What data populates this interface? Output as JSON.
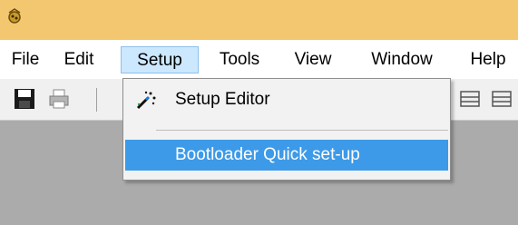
{
  "colors": {
    "titlebar": "#f2c76f",
    "menubar": "#ffffff",
    "workspace": "#ababab",
    "toolbar": "#f0f0f0",
    "highlight": "#3d9ae8"
  },
  "window": {
    "app_icon": "app-logo-icon"
  },
  "menubar": {
    "items": [
      {
        "label": "File"
      },
      {
        "label": "Edit"
      },
      {
        "label": "Setup",
        "active": true
      },
      {
        "label": "Tools"
      },
      {
        "label": "View"
      },
      {
        "label": "Window"
      },
      {
        "label": "Help"
      }
    ]
  },
  "toolbar": {
    "buttons": [
      {
        "icon": "save-icon"
      },
      {
        "icon": "print-icon"
      },
      {
        "icon": "layout-icon"
      },
      {
        "icon": "layout-alt-icon"
      }
    ]
  },
  "setup_menu": {
    "items": [
      {
        "label": "Setup Editor",
        "icon": "magic-wand-icon"
      },
      {
        "label": "Bootloader Quick set-up",
        "highlighted": true
      }
    ]
  }
}
